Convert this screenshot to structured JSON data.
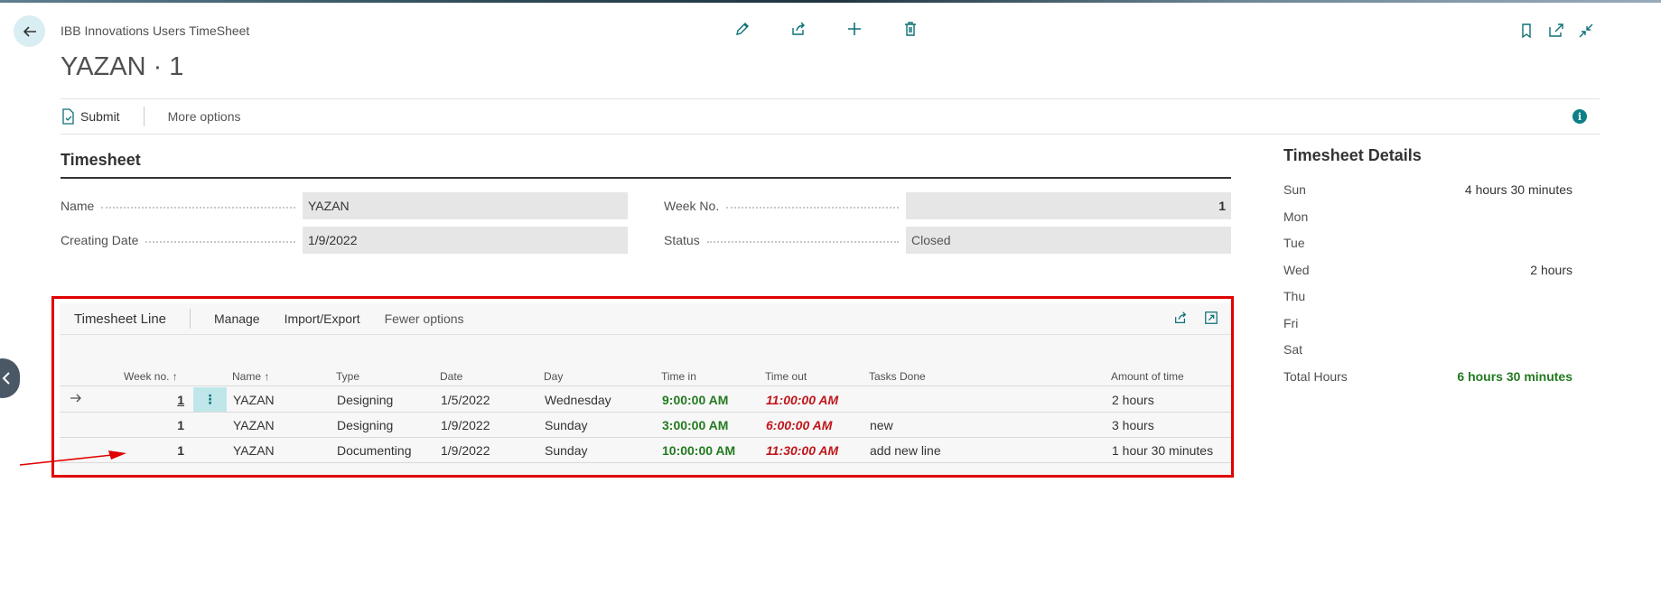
{
  "header": {
    "breadcrumb": "IBB Innovations Users TimeSheet",
    "title": "YAZAN · 1"
  },
  "actionbar": {
    "submit": "Submit",
    "more_options": "More options"
  },
  "general": {
    "section_title": "Timesheet",
    "name_label": "Name",
    "name_value": "YAZAN",
    "date_label": "Creating Date",
    "date_value": "1/9/2022",
    "week_label": "Week No.",
    "week_value": "1",
    "status_label": "Status",
    "status_value": "Closed"
  },
  "details": {
    "title": "Timesheet Details",
    "rows": [
      {
        "label": "Sun",
        "value": "4 hours 30 minutes"
      },
      {
        "label": "Mon",
        "value": ""
      },
      {
        "label": "Tue",
        "value": ""
      },
      {
        "label": "Wed",
        "value": "2 hours"
      },
      {
        "label": "Thu",
        "value": ""
      },
      {
        "label": "Fri",
        "value": ""
      },
      {
        "label": "Sat",
        "value": ""
      },
      {
        "label": "Total Hours",
        "value": "6 hours 30 minutes"
      }
    ]
  },
  "lines": {
    "title": "Timesheet Line",
    "actions": {
      "manage": "Manage",
      "import_export": "Import/Export",
      "fewer": "Fewer options"
    },
    "columns": {
      "week": "Week no. ↑",
      "name": "Name ↑",
      "type": "Type",
      "date": "Date",
      "day": "Day",
      "time_in": "Time in",
      "time_out": "Time out",
      "tasks": "Tasks Done",
      "amount": "Amount of time"
    },
    "rows": [
      {
        "week": "1",
        "name": "YAZAN",
        "type": "Designing",
        "date": "1/5/2022",
        "day": "Wednesday",
        "time_in": "9:00:00 AM",
        "time_out": "11:00:00 AM",
        "tasks": "",
        "amount": "2 hours"
      },
      {
        "week": "1",
        "name": "YAZAN",
        "type": "Designing",
        "date": "1/9/2022",
        "day": "Sunday",
        "time_in": "3:00:00 AM",
        "time_out": "6:00:00 AM",
        "tasks": "new",
        "amount": "3 hours"
      },
      {
        "week": "1",
        "name": "YAZAN",
        "type": "Documenting",
        "date": "1/9/2022",
        "day": "Sunday",
        "time_in": "10:00:00 AM",
        "time_out": "11:30:00 AM",
        "tasks": "add new line",
        "amount": "1 hour 30 minutes"
      }
    ]
  },
  "colors": {
    "accent": "#0d7f87",
    "time_in": "#237a1f",
    "time_out": "#c0161b",
    "highlight": "#e00000"
  }
}
